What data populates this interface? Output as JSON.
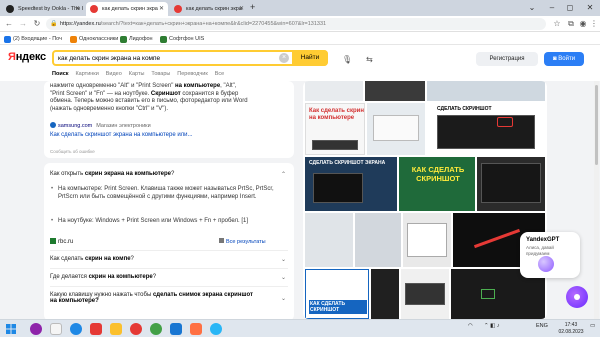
{
  "browser": {
    "tabs": [
      {
        "label": "Speedtest by Ookla - The I",
        "fav_color": "#222222"
      },
      {
        "label": "как делать скрин экра",
        "fav_color": "#e53935"
      },
      {
        "label": "как делать скрин экра",
        "fav_color": "#e53935"
      }
    ],
    "new_tab_label": "+",
    "win_controls": [
      "⌄",
      "–",
      "◻",
      "✕"
    ],
    "url_domain": "https://yandex.ru",
    "url_rest": "/search/?text=как+делать+скрин+экрана+на+компе&lr&clid=2270455&win=607&lr=131331",
    "nav": {
      "back": "←",
      "forward": "→",
      "reload": "↻"
    },
    "bookmarks": [
      {
        "label": "(2) Входящие - Поч",
        "color": "#1a73e8"
      },
      {
        "label": "Одноклассники",
        "color": "#ee8208"
      },
      {
        "label": "Лидофон",
        "color": "#2e7d32"
      },
      {
        "label": "Софтфон UIS",
        "color": "#2e7d32"
      }
    ]
  },
  "yandex": {
    "logo_first": "Я",
    "logo_rest": "ндекс",
    "search_value": "как делать скрин экрана на компе",
    "find_label": "Найти",
    "register_label": "Регистрация",
    "login_label": "Войти",
    "tabs": [
      "Поиск",
      "Картинки",
      "Видео",
      "Карты",
      "Товары",
      "Переводчик",
      "Все"
    ]
  },
  "result1": {
    "line1a": "нажмите одновременно \"Alt\" и \"Print Screen\"",
    "line1b": "на компьютере",
    "line1c": ", \"Alt\",",
    "line2": "\"Print Screen\" и \"Fn\" — на ноутбуке.",
    "line2b": "Скриншот",
    "line2c": "сохранится в буфер",
    "line3": "обмена. Теперь можно вставить его в письмо, фоторедактор или Word",
    "line4": "(нажать одновременно кнопки \"Ctrl\" и \"V\").",
    "source_domain": "samsung.com",
    "source_name": "Магазин электроники",
    "link": "Как сделать скриншот экрана на компьютере или...",
    "report": "Сообщить об ошибке"
  },
  "faq": {
    "q1a": "Как открыть",
    "q1b": "скрин экрана на компьютере",
    "q1c": "?",
    "b1": "На компьютере: Print Screen. Клавиша также может называться PrtSc, PrtScr, PrtScrn или быть совмещённой с другими функциями, например Insert.",
    "b2": "На ноутбуке: Windows + Print Screen или Windows + Fn + пробел.",
    "b2ref": "[1]",
    "source": "rbc.ru",
    "all_results": "Все результаты",
    "q2a": "Как сделать",
    "q2b": "скрин на компе",
    "q2c": "?",
    "q3a": "Где делается",
    "q3b": "скрин на компьютере",
    "q3c": "?",
    "q4a": "Какую клавишу нужно нажать чтобы",
    "q4b": "сделать снимок экрана скриншот",
    "q4c": "на компьютере?"
  },
  "images": {
    "t1": "Как сделать скрин на компьютере",
    "t2": "СДЕЛАТЬ СКРИНШОТ",
    "t3": "СДЕЛАТЬ СКРИНШОТ ЭКРАНА",
    "t4": "КАК СДЕЛАТЬ СКРИНШОТ",
    "t5": "КАК СДЕЛАТЬ СКРИНШОТ"
  },
  "gpt": {
    "title": "YandexGPT",
    "subtitle": "Алиса, давай придумаем"
  },
  "taskbar": {
    "lang": "ENG",
    "time": "17:43",
    "date": "02.08.2023"
  }
}
